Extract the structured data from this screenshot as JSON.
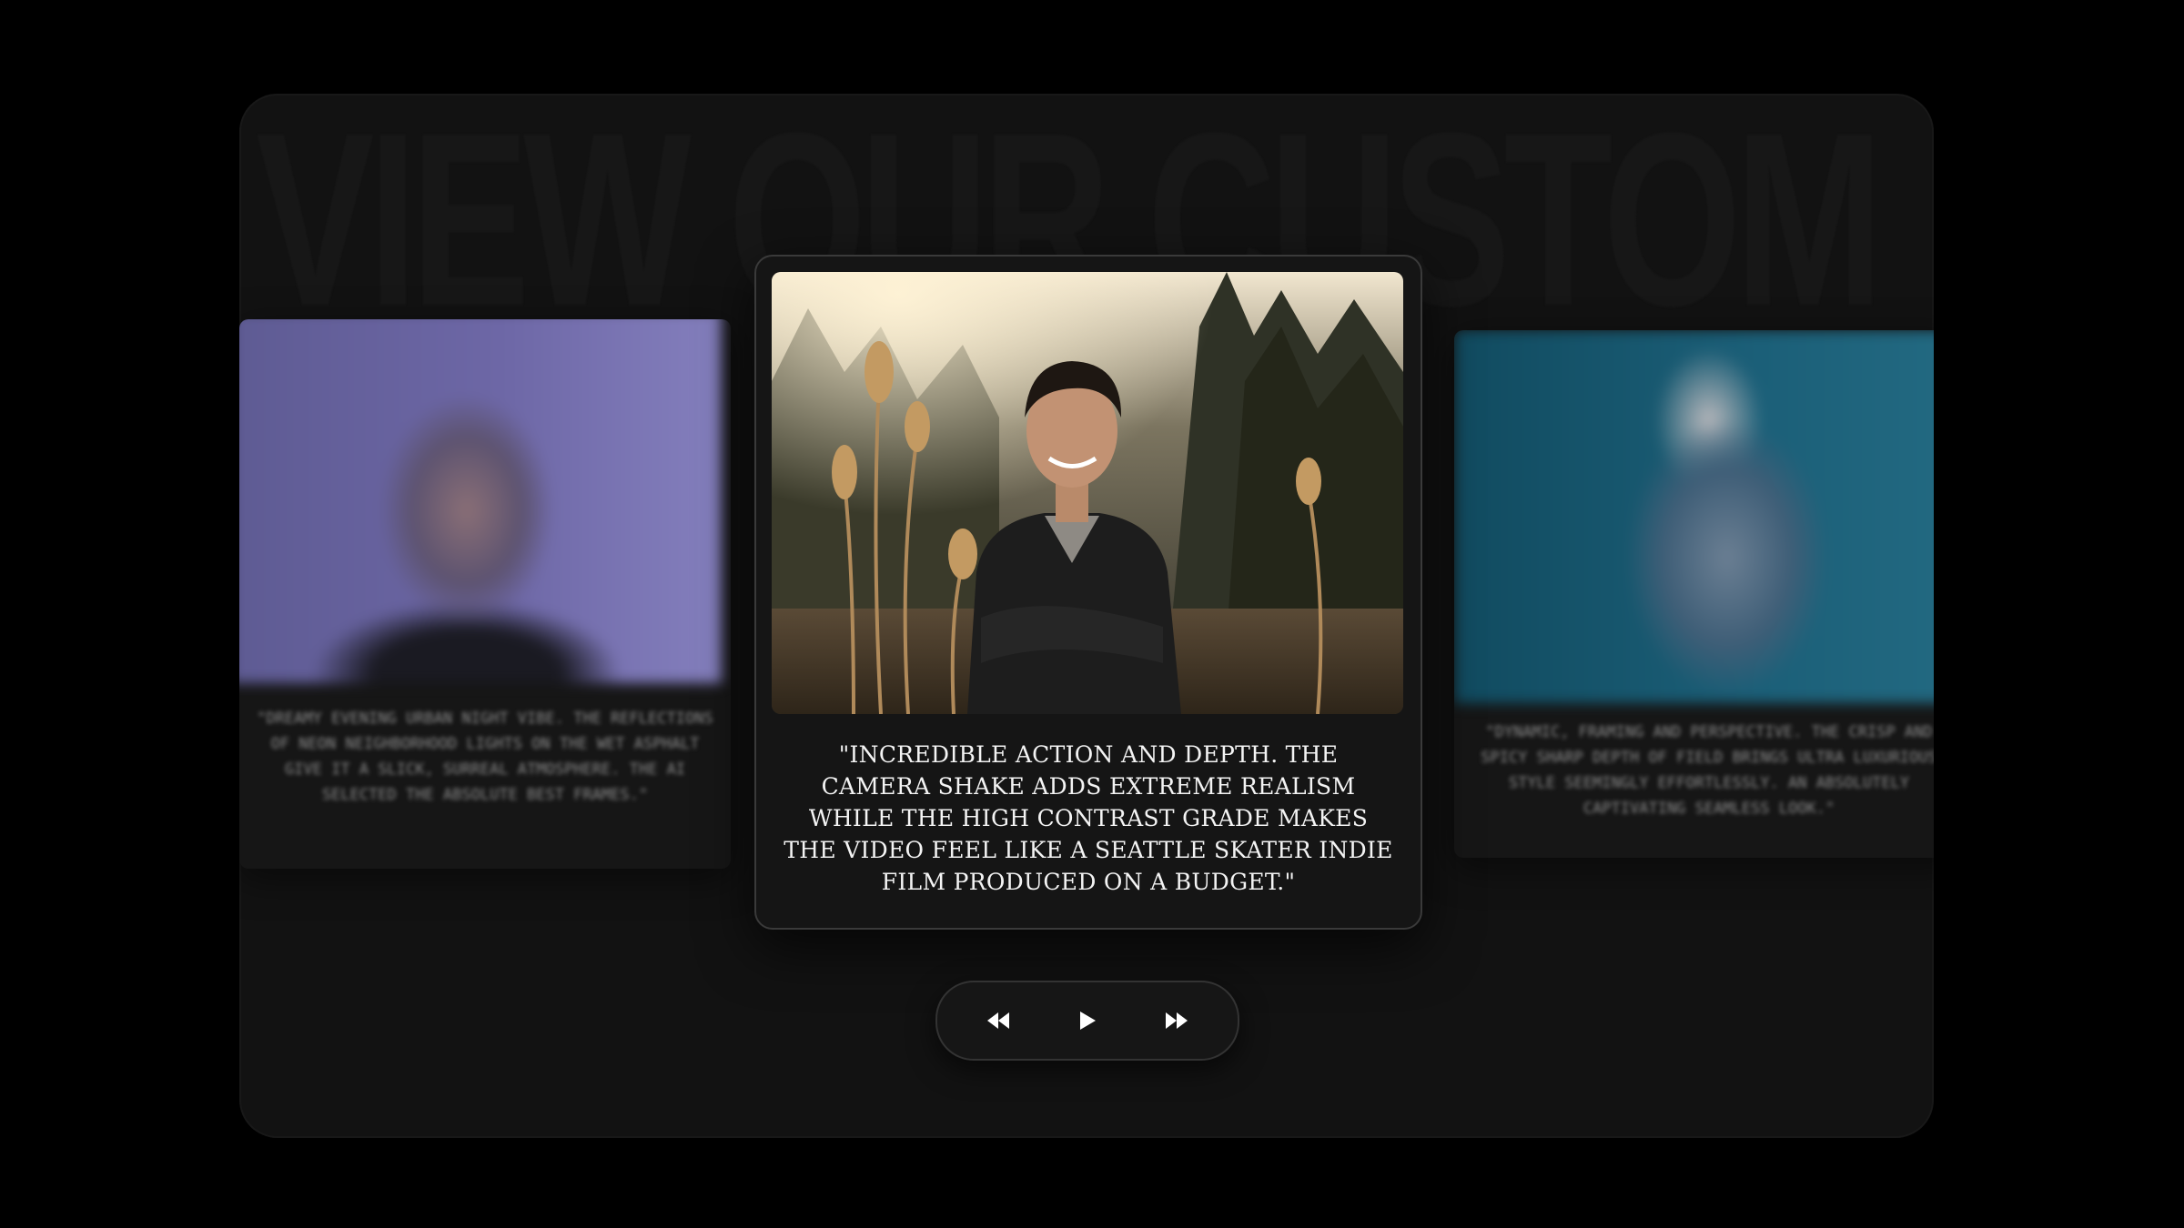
{
  "background_title": "VIEW OUR CUSTOM",
  "cards": {
    "left": {
      "quote": "\"Dreamy evening urban night vibe. The reflections of neon neighborhood lights on the wet asphalt give it a slick, surreal atmosphere. The AI selected the absolute best frames.\""
    },
    "center": {
      "quote": "\"Incredible action and depth. The camera shake adds extreme realism while the high contrast grade makes the video feel like a Seattle skater indie film produced on a budget.\""
    },
    "right": {
      "quote": "\"Dynamic, framing and perspective. The crisp and spicy sharp depth of field brings ultra luxurious style seemingly effortlessly. An absolutely captivating seamless look.\""
    }
  },
  "controls": {
    "rewind_icon": "rewind-icon",
    "play_icon": "play-icon",
    "forward_icon": "fast-forward-icon"
  },
  "colors": {
    "page_bg": "#000000",
    "panel_bg": "#121212",
    "card_bg": "#151515",
    "text": "#f4f4f4"
  }
}
